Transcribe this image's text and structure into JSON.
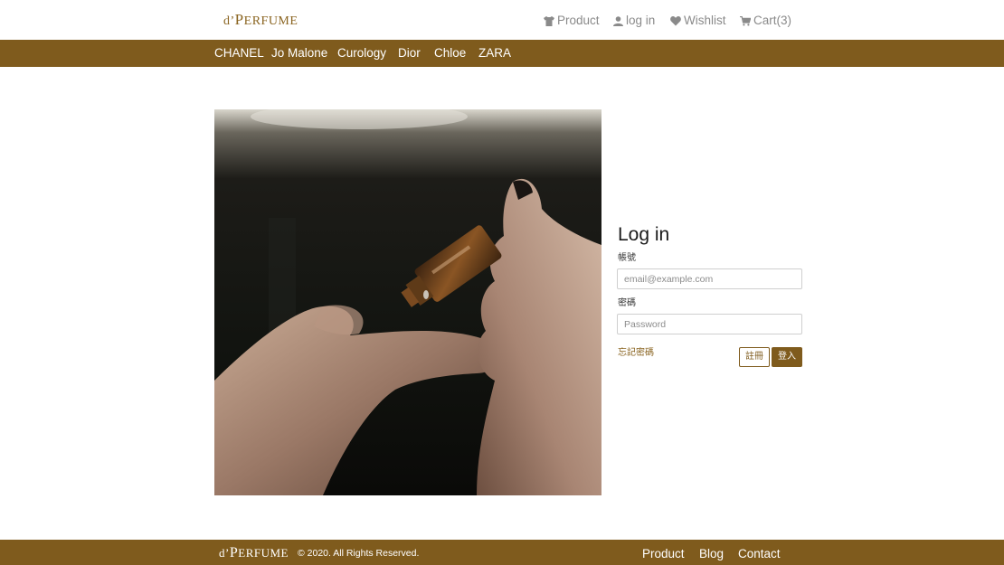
{
  "brand": {
    "logo_prefix": "d’",
    "logo_initial": "P",
    "logo_rest": "ERFUME",
    "accent_color": "#7f5b1d"
  },
  "header": {
    "nav": [
      {
        "label": "Product",
        "icon": "shirt-icon"
      },
      {
        "label": "log in",
        "icon": "user-icon"
      },
      {
        "label": "Wishlist",
        "icon": "heart-icon"
      },
      {
        "label": "Cart(3)",
        "icon": "cart-icon"
      }
    ]
  },
  "categories": [
    "CHANEL",
    "Jo Malone",
    "Curology",
    "Dior",
    "Chloe",
    "ZARA"
  ],
  "login": {
    "title": "Log in",
    "account_label": "帳號",
    "account_placeholder": "email@example.com",
    "password_label": "密碼",
    "password_placeholder": "Password",
    "forgot_label": "忘記密碼",
    "register_label": "註冊",
    "submit_label": "登入"
  },
  "footer": {
    "copyright": "© 2020. All Rights Reserved.",
    "links": [
      "Product",
      "Blog",
      "Contact"
    ]
  }
}
